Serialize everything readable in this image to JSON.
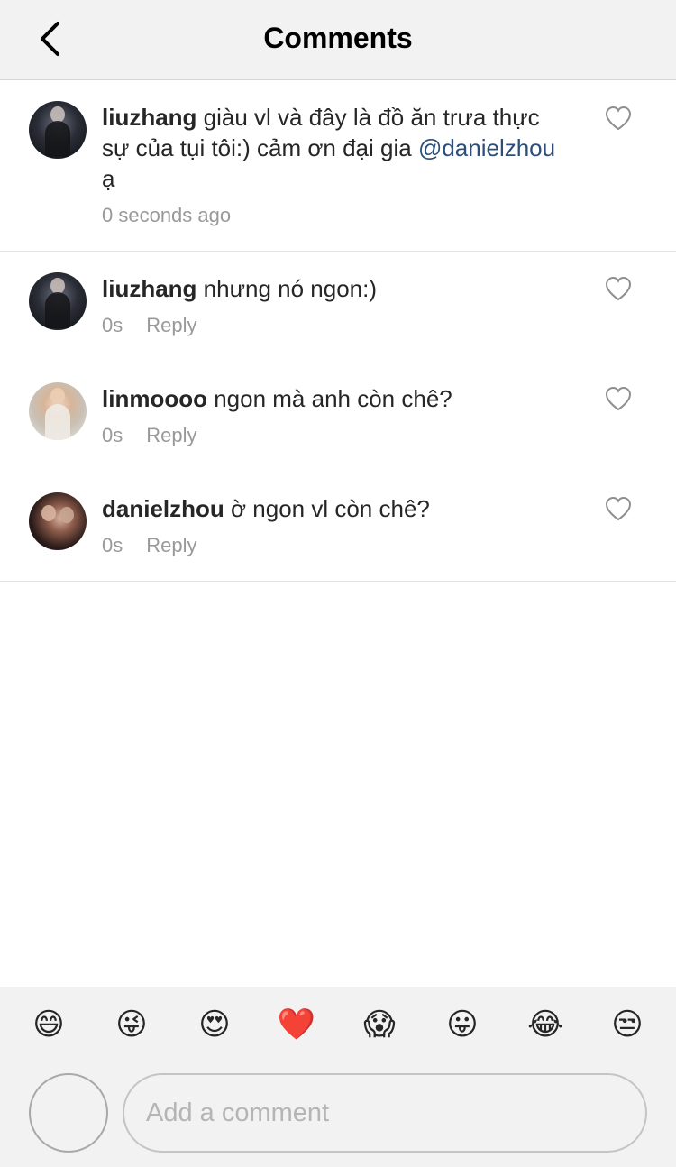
{
  "header": {
    "title": "Comments",
    "back_icon": "chevron-left-icon"
  },
  "caption": {
    "username": "liuzhang",
    "text_before_mention": " giàu vl và đây là đồ ăn trưa thực sự của tụi tôi:) cảm ơn đại gia ",
    "mention": "@danielzhou",
    "text_after_mention": " ạ",
    "timestamp": "0 seconds ago"
  },
  "comments": [
    {
      "username": "liuzhang",
      "text": " nhưng nó ngon:)",
      "time": "0s",
      "reply_label": "Reply"
    },
    {
      "username": "linmoooo",
      "text": " ngon mà anh còn chê?",
      "time": "0s",
      "reply_label": "Reply"
    },
    {
      "username": "danielzhou",
      "text": " ờ ngon vl còn chê?",
      "time": "0s",
      "reply_label": "Reply"
    }
  ],
  "emojis": [
    "😄",
    "😜",
    "😍",
    "❤️",
    "😱",
    "😛",
    "😂",
    "😒"
  ],
  "composer": {
    "placeholder": "Add a comment"
  },
  "colors": {
    "mention": "#2d4e7a",
    "meta": "#999999",
    "background": "#f2f2f2"
  }
}
